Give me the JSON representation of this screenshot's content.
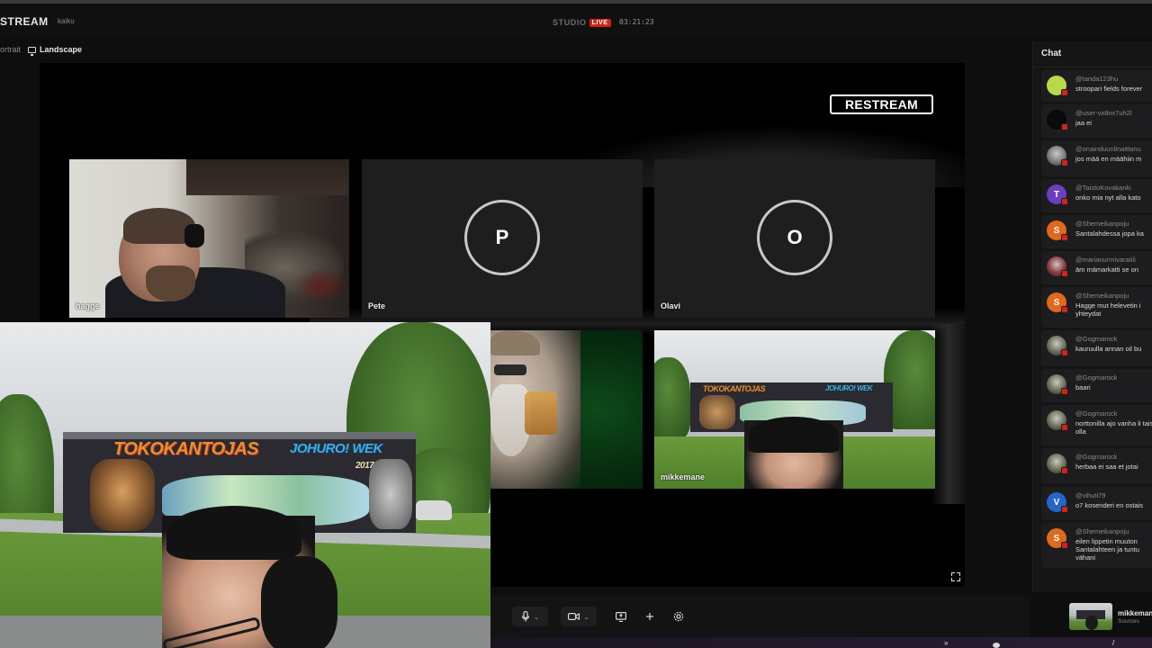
{
  "app": {
    "brand": "STREAM",
    "channel": "kaiku",
    "studio_label": "STUDIO",
    "live_label": "LIVE",
    "timer": "03:21:23"
  },
  "orientation": {
    "portrait_label": "ortrait",
    "landscape_label": "Landscape"
  },
  "stage": {
    "logo_text": "RESTREAM",
    "tiles": [
      {
        "id": "hagge",
        "name": "hagge",
        "type": "video"
      },
      {
        "id": "pete",
        "name": "Pete",
        "type": "avatar",
        "initial": "P"
      },
      {
        "id": "olavi",
        "name": "Olavi",
        "type": "avatar",
        "initial": "O"
      },
      {
        "id": "mikkemane",
        "name": "mikkemane",
        "type": "video"
      }
    ],
    "graffiti_top": "TOKOKANTOJAS",
    "graffiti_right": "JOHURO! WEK",
    "graffiti_date": "2017"
  },
  "controls": {
    "mic": "microphone-icon",
    "camera": "camera-icon",
    "share": "screen-share-icon",
    "add": "plus-icon",
    "settings": "gear-icon"
  },
  "chat": {
    "title": "Chat",
    "messages": [
      {
        "user": "@tanda123hu",
        "text": "stroopari fields forever",
        "avatar": "emoji",
        "color": "#b8d94a"
      },
      {
        "user": "@user-vx8nx7uh2l",
        "text": "jaa ei",
        "avatar": "dark",
        "color": "#0a0a0a"
      },
      {
        "user": "@onainduunlinaittanu",
        "text": "jos mää en määhiin m",
        "avatar": "photo",
        "color": "#7a7a7a"
      },
      {
        "user": "@TaistoKovakanki",
        "text": "onko mia nyt alla kato",
        "avatar": "T",
        "color": "#6b3fc1"
      },
      {
        "user": "@Shemeikanpoju",
        "text": "Santalahdessa jopa ka",
        "avatar": "S",
        "color": "#e06a1c"
      },
      {
        "user": "@marianurmivaratili",
        "text": "äm mämarkatti se on",
        "avatar": "photo",
        "color": "#8a3a3a"
      },
      {
        "user": "@Shemeikanpoju",
        "text": "Hagge mut helevetin i yhteydat",
        "avatar": "S",
        "color": "#e06a1c"
      },
      {
        "user": "@Gogmarock",
        "text": "kauruulla annan oil bu",
        "avatar": "photo",
        "color": "#6b6b55"
      },
      {
        "user": "@Gogmarock",
        "text": "baari",
        "avatar": "photo",
        "color": "#6b6b55"
      },
      {
        "user": "@Gogmarock",
        "text": "norttonilla ajo vanha li tais olla",
        "avatar": "photo",
        "color": "#6b6b55"
      },
      {
        "user": "@Gogmarock",
        "text": "herbaa ei saa et jotai",
        "avatar": "photo",
        "color": "#6b6b55"
      },
      {
        "user": "@vihuti79",
        "text": "o7 kosenderi en ostais",
        "avatar": "V",
        "color": "#2566c6"
      },
      {
        "user": "@Shemeikanpoju",
        "text": "eilen lippetin muuton Santalahteen ja tuntu vähani",
        "avatar": "S",
        "color": "#e06a1c"
      }
    ]
  },
  "self_preview": {
    "name": "mikkemane",
    "subtitle": "Sources"
  }
}
